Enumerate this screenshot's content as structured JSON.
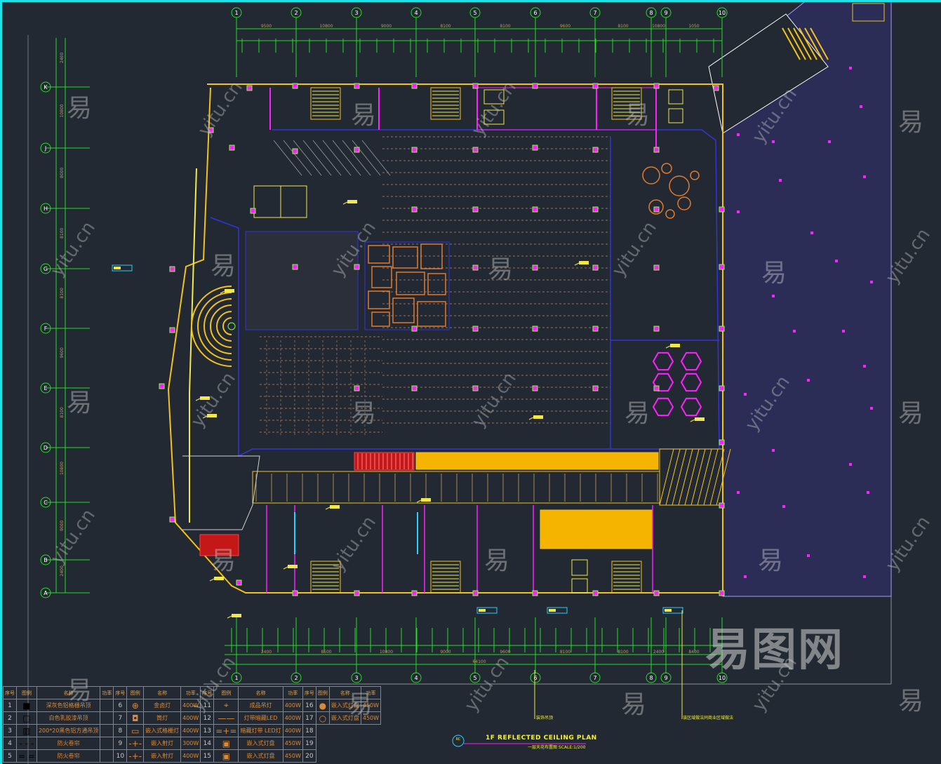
{
  "drawing": {
    "title": "1F REFLECTED CEILING PLAN",
    "subtitle": "一层天花布置图  SCALE:1/200",
    "callout_symbol": "RC",
    "notes": [
      "装饰吊顶",
      "该区域做法同商业区域做法"
    ],
    "axis_top": [
      "1",
      "2",
      "3",
      "4",
      "5",
      "6",
      "7",
      "8",
      "9",
      "10"
    ],
    "axis_left": [
      "K",
      "J",
      "H",
      "G",
      "F",
      "E",
      "D",
      "C",
      "B",
      "A"
    ],
    "dims_top_overall": [
      "9500",
      "10800",
      "9000",
      "8100",
      "8100",
      "9600",
      "8100",
      "10800",
      "1050"
    ],
    "dims_bottom_overall": [
      "2400",
      "8500",
      "10800",
      "9000",
      "9600",
      "8100",
      "8100",
      "2400",
      "8400"
    ],
    "dims_bottom_total": "64100",
    "dims_left": [
      "2400",
      "10800",
      "8000",
      "8100",
      "8100",
      "9600",
      "8100",
      "10800",
      "9000",
      "2400"
    ]
  },
  "legend": {
    "headers": [
      "序号",
      "图例",
      "名称",
      "功率"
    ],
    "rows": [
      [
        {
          "n": "1",
          "name": "深灰色铝格栅吊顶",
          "w": ""
        },
        {
          "n": "6",
          "name": "金卤灯",
          "w": "400W"
        },
        {
          "n": "11",
          "name": "成品吊灯",
          "w": "400W"
        },
        {
          "n": "16",
          "name": "嵌入式灯盘",
          "w": "450W"
        }
      ],
      [
        {
          "n": "2",
          "name": "白色乳胶漆吊顶",
          "w": ""
        },
        {
          "n": "7",
          "name": "筒灯",
          "w": "400W"
        },
        {
          "n": "12",
          "name": "灯带暗藏LED",
          "w": "400W"
        },
        {
          "n": "17",
          "name": "嵌入式灯盘",
          "w": "450W"
        }
      ],
      [
        {
          "n": "3",
          "name": "200*20黑色铝方通吊顶",
          "w": ""
        },
        {
          "n": "8",
          "name": "嵌入式格栅灯",
          "w": "400W"
        },
        {
          "n": "13",
          "name": "暗藏灯带 LED灯",
          "w": "400W"
        },
        {
          "n": "18",
          "name": "",
          "w": ""
        }
      ],
      [
        {
          "n": "4",
          "name": "防火卷帘",
          "w": ""
        },
        {
          "n": "9",
          "name": "嵌入射灯",
          "w": "300W"
        },
        {
          "n": "14",
          "name": "嵌入式灯盘",
          "w": "450W"
        },
        {
          "n": "19",
          "name": "",
          "w": ""
        }
      ],
      [
        {
          "n": "5",
          "name": "防火卷帘",
          "w": ""
        },
        {
          "n": "10",
          "name": "嵌入射灯",
          "w": "400W"
        },
        {
          "n": "15",
          "name": "嵌入式灯盘",
          "w": "450W"
        },
        {
          "n": "20",
          "name": "",
          "w": ""
        }
      ]
    ]
  },
  "watermark": {
    "char": "易",
    "site": "yitu.cn",
    "logo": "易图网"
  },
  "colors": {
    "bg": "#232932",
    "axis": "#22e022",
    "wall": "#f2c21a",
    "partition": "#3434d8",
    "light": "#ff20ff",
    "ceiling": "#e07a30",
    "annex": "#2b2d57"
  }
}
